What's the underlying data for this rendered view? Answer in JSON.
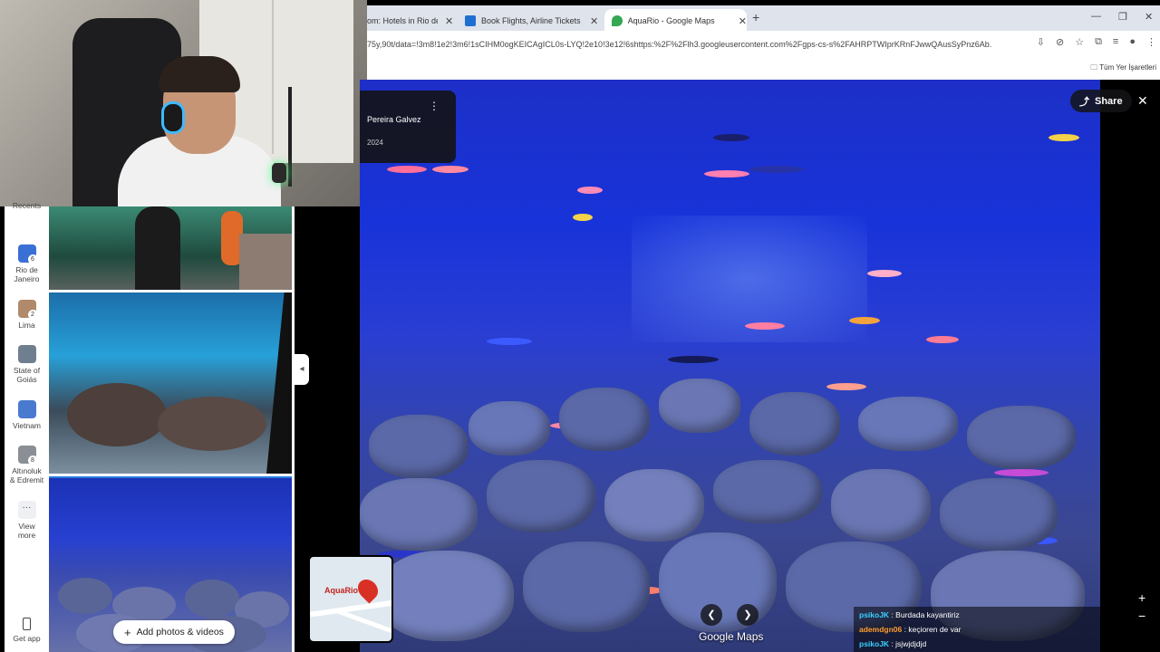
{
  "browser": {
    "tabs": [
      {
        "title": "om: Hotels in Rio de",
        "favicon_color": "#4a6fd1"
      },
      {
        "title": "Book Flights, Airline Tickets & t",
        "favicon_color": "#1f6fd1"
      },
      {
        "title": "AquaRio - Google Maps",
        "favicon_color": "#34a853"
      }
    ],
    "url": "75y,90t/data=!3m8!1e2!3m6!1sCIHM0ogKEICAgICL0s-LYQ!2e10!3e12!6shttps:%2F%2Flh3.googleusercontent.com%2Fgps-cs-s%2FAHRPTWIprKRnFJwwQAusSyPnz6Ab...",
    "bookmarks_label": "Tüm Yer İşaretleri"
  },
  "rail": {
    "recents_label": "Recents",
    "items": [
      {
        "label1": "Rio de",
        "label2": "Janeiro",
        "badge": "6",
        "color": "#3a6fd6"
      },
      {
        "label1": "Lima",
        "label2": "",
        "badge": "2",
        "color": "#b08a6a"
      },
      {
        "label1": "State of",
        "label2": "Goiás",
        "badge": "",
        "color": "#6f7f8f"
      },
      {
        "label1": "Vietnam",
        "label2": "",
        "badge": "",
        "color": "#4a7ad0"
      },
      {
        "label1": "Altınoluk",
        "label2": "& Edremit",
        "badge": "8",
        "color": "#8a8f95"
      }
    ],
    "view_more": "View more",
    "get_app": "Get app"
  },
  "panel": {
    "add_photos": "Add photos & videos"
  },
  "viewer": {
    "author_name": "Pereira Galvez",
    "author_date": "2024",
    "share_label": "Share",
    "watermark": "Google Maps",
    "minimap_label": "AquaRio"
  },
  "chat": [
    {
      "user": "psikoJK",
      "message": "Burdada kayantiriz",
      "color": "#3ad1ff"
    },
    {
      "user": "ademdgn06",
      "message": "keçioren de var",
      "color": "#ff9d2e"
    },
    {
      "user": "psikoJK",
      "message": "jsjwjdjdjd",
      "color": "#3ad1ff"
    }
  ]
}
